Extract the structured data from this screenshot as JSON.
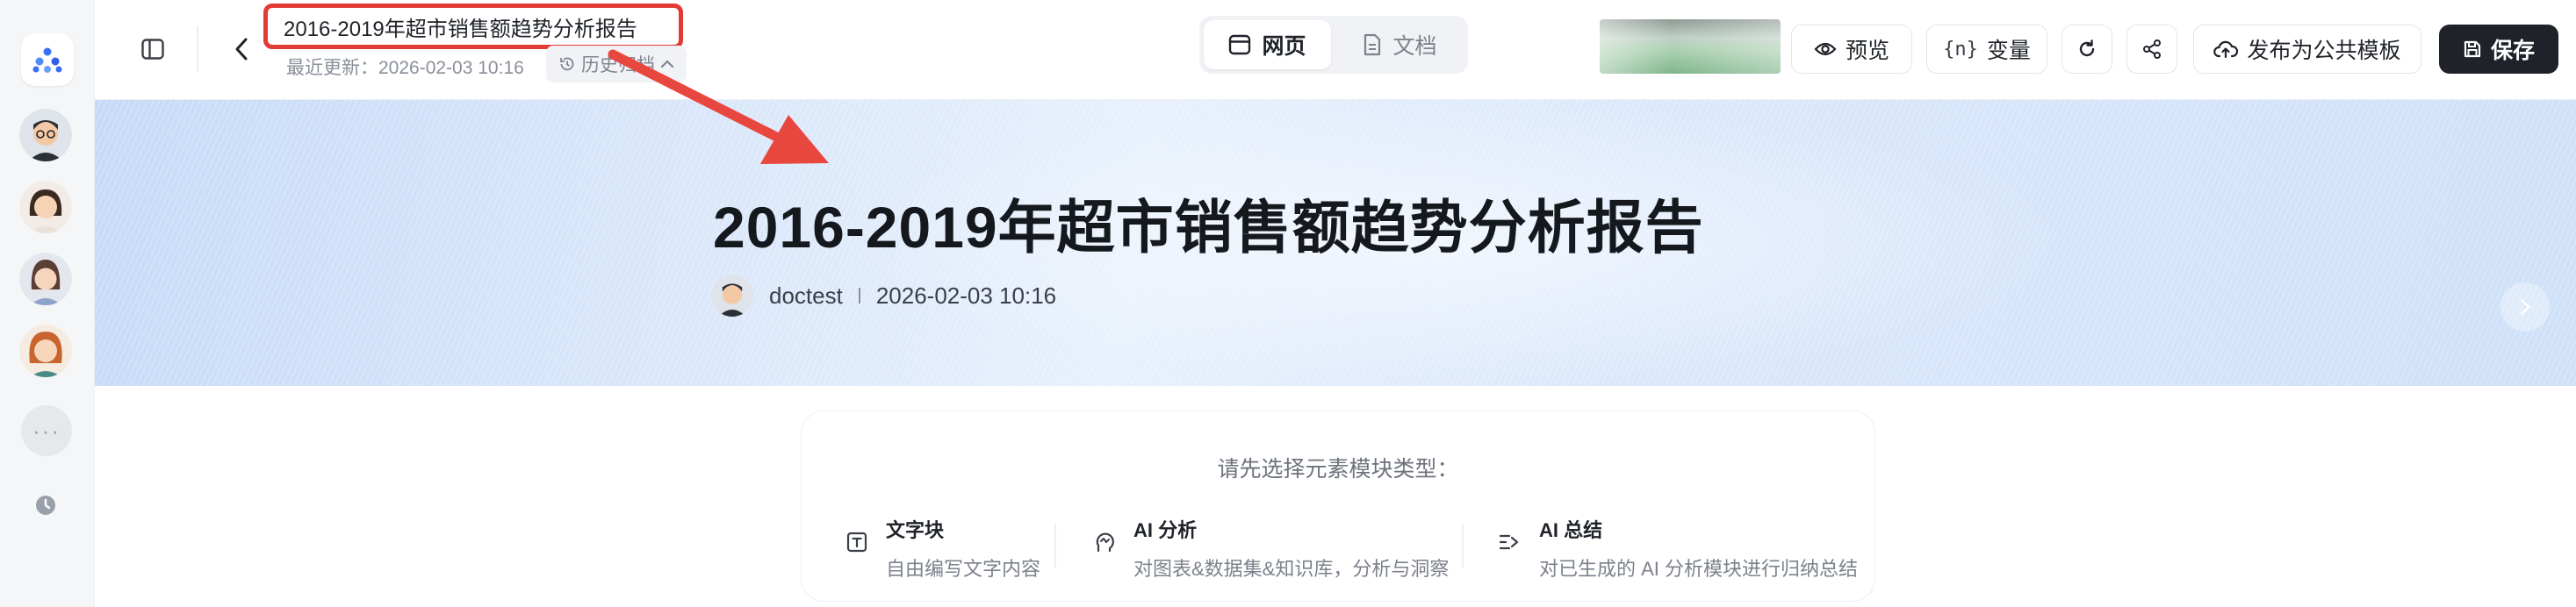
{
  "document": {
    "title": "2016-2019年超市销售额趋势分析报告",
    "updated_text": "最近更新：2026-02-03 10:16",
    "history_label": "历史归档"
  },
  "view_tabs": [
    {
      "label": "网页",
      "active": true,
      "icon": "webpage-icon"
    },
    {
      "label": "文档",
      "active": false,
      "icon": "document-icon"
    }
  ],
  "toolbar": {
    "preview_label": "预览",
    "variables_icon_text": "{n}",
    "variables_label": "变量",
    "publish_label": "发布为公共模板",
    "save_label": "保存"
  },
  "banner": {
    "title": "2016-2019年超市销售额趋势分析报告",
    "author": "doctest",
    "date": "2026-02-03 10:16"
  },
  "chooser": {
    "prompt": "请先选择元素模块类型：",
    "options": [
      {
        "title": "文字块",
        "desc": "自由编写文字内容",
        "icon": "text-block-icon"
      },
      {
        "title": "AI 分析",
        "desc": "对图表&数据集&知识库，分析与洞察",
        "icon": "ai-analysis-icon"
      },
      {
        "title": "AI 总结",
        "desc": "对已生成的 AI 分析模块进行归纳总结",
        "icon": "ai-summary-icon"
      }
    ]
  },
  "colors": {
    "highlight_red": "#e23b35",
    "primary_dark": "#1f2329",
    "brand_blue": "#3b6ff5"
  }
}
